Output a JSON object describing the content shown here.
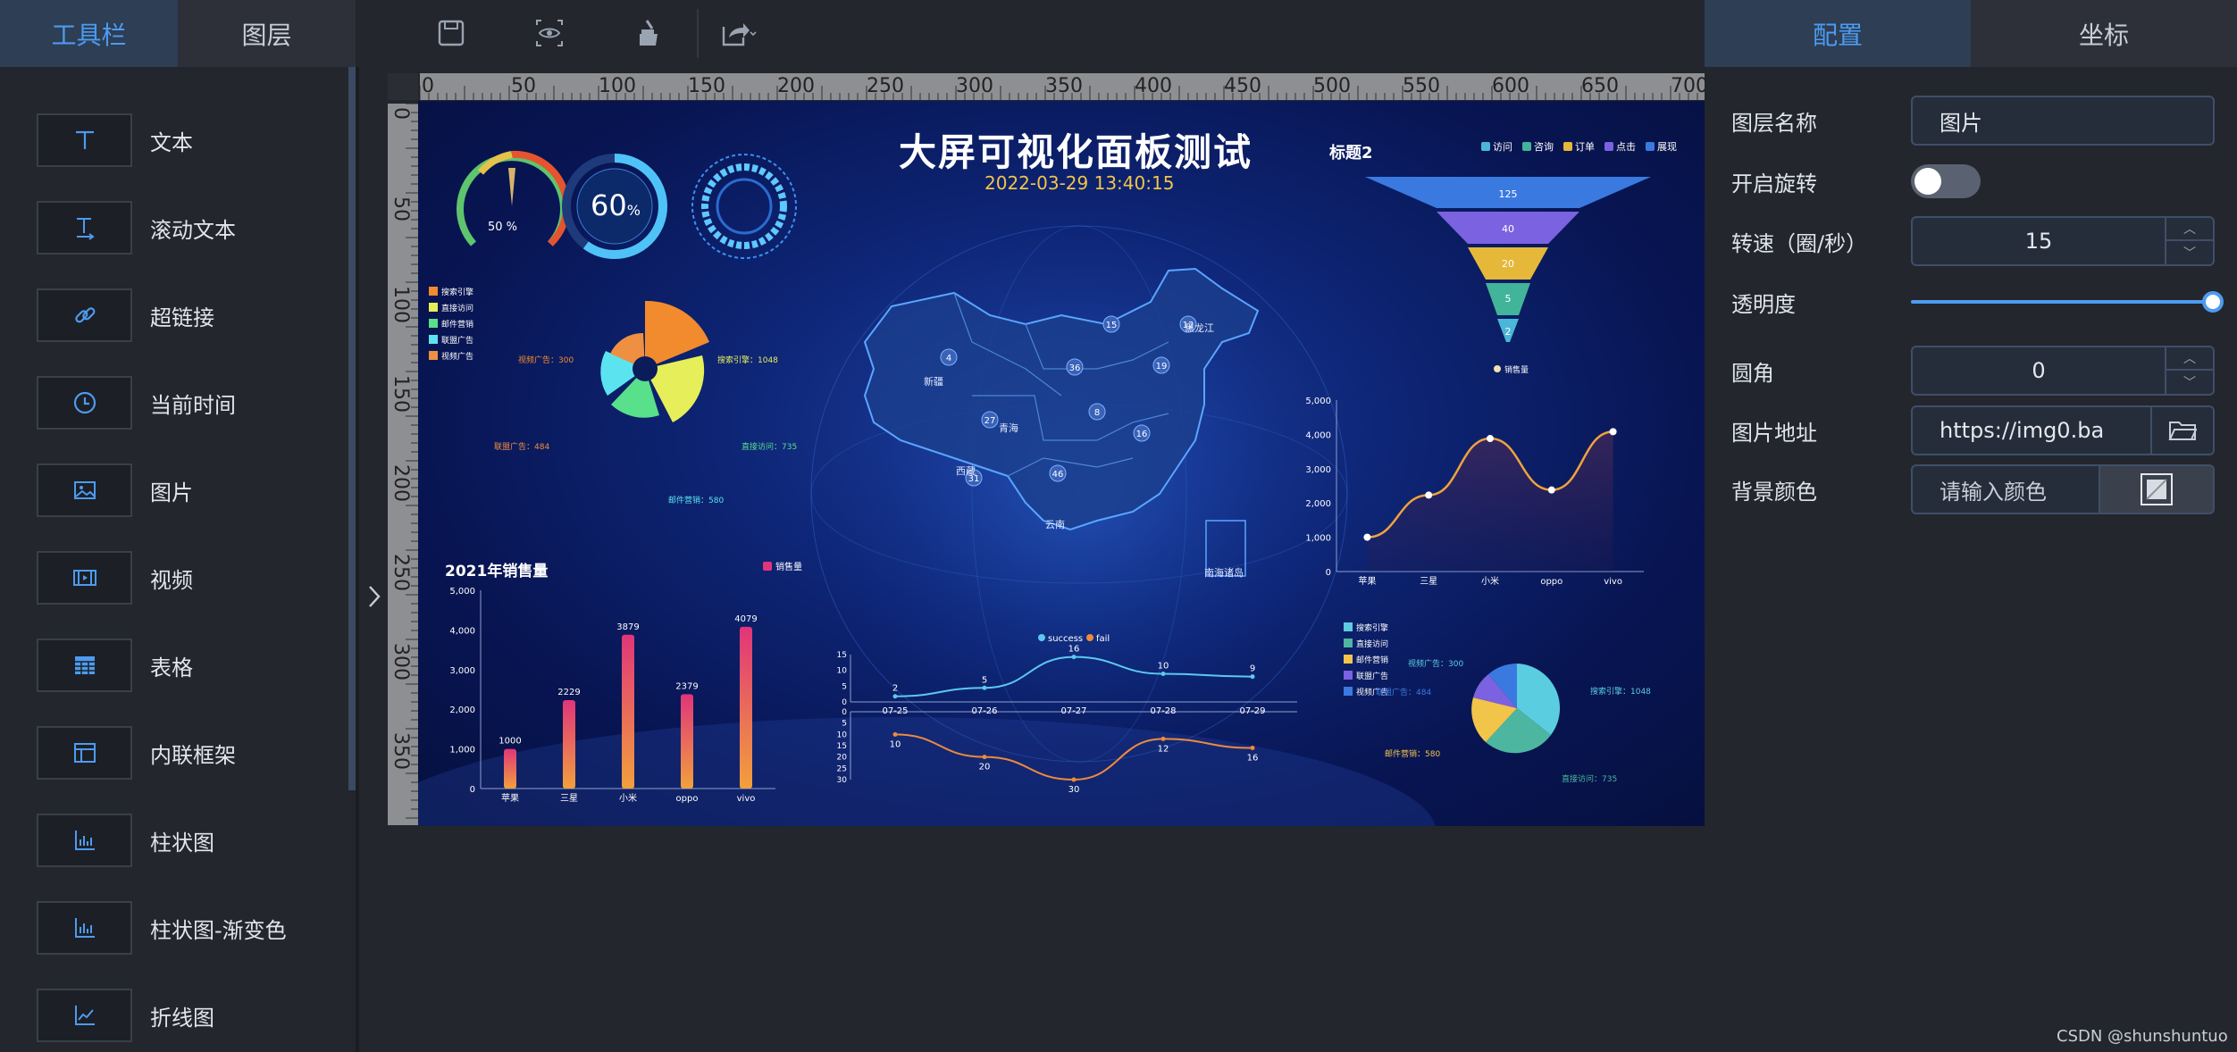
{
  "left_tabs": [
    "工具栏",
    "图层"
  ],
  "tools": [
    {
      "label": "文本",
      "icon": "text-icon"
    },
    {
      "label": "滚动文本",
      "icon": "scroll-text-icon"
    },
    {
      "label": "超链接",
      "icon": "link-icon"
    },
    {
      "label": "当前时间",
      "icon": "clock-icon"
    },
    {
      "label": "图片",
      "icon": "image-icon"
    },
    {
      "label": "视频",
      "icon": "video-icon"
    },
    {
      "label": "表格",
      "icon": "table-icon"
    },
    {
      "label": "内联框架",
      "icon": "iframe-icon"
    },
    {
      "label": "柱状图",
      "icon": "bar-chart-icon"
    },
    {
      "label": "柱状图-渐变色",
      "icon": "bar-gradient-icon"
    },
    {
      "label": "折线图",
      "icon": "line-chart-icon"
    }
  ],
  "top_toolbar": [
    "save-icon",
    "preview-icon",
    "clear-icon",
    "export-icon"
  ],
  "ruler": {
    "top_ticks": [
      "0",
      "50",
      "100",
      "150",
      "200",
      "250",
      "300",
      "350",
      "400",
      "450",
      "500",
      "550",
      "600",
      "650",
      "700"
    ],
    "left_ticks": [
      "0",
      "50",
      "100",
      "150",
      "200",
      "250",
      "300",
      "350"
    ]
  },
  "dashboard": {
    "title": "大屏可视化面板测试",
    "datetime": "2022-03-29 13:40:15",
    "subtitle": "标题2",
    "gauge_value": "50 %",
    "progress": "60",
    "progress_unit": "%",
    "funnel_legend": [
      "访问",
      "咨询",
      "订单",
      "点击",
      "展现"
    ],
    "funnel_values": [
      "125",
      "40",
      "20",
      "5",
      "2"
    ],
    "rose_legend": [
      "搜索引擎",
      "直接访问",
      "邮件营销",
      "联盟广告",
      "视频广告"
    ],
    "rose_labels": [
      "视频广告：300",
      "搜索引擎：1048",
      "直接访问：735",
      "邮件营销：580",
      "联盟广告：484"
    ],
    "sales_title": "2021年销售量",
    "sales_legend": "销售量",
    "line_legend": "销售量",
    "dual_legend": [
      "success",
      "fail"
    ],
    "dual_dates": [
      "07-25",
      "07-26",
      "07-27",
      "07-28",
      "07-29"
    ],
    "dual_success": [
      "2",
      "5",
      "16",
      "10",
      "9"
    ],
    "dual_fail": [
      "10",
      "20",
      "30",
      "12",
      "16"
    ],
    "pie_legend": [
      "搜索引擎",
      "直接访问",
      "邮件营销",
      "联盟广告",
      "视频广告"
    ],
    "pie_labels": [
      "视频广告：300",
      "联盟广告：484",
      "搜索引擎：1048",
      "邮件营销：580",
      "直接访问：735"
    ],
    "map_labels": [
      "新疆",
      "青海",
      "西藏",
      "云南",
      "黑龙江",
      "南海诸岛"
    ],
    "map_numbers": [
      "4",
      "27",
      "31",
      "15",
      "19",
      "8",
      "36",
      "46",
      "16",
      "12"
    ]
  },
  "chart_data": [
    {
      "type": "bar",
      "title": "2021年销售量",
      "categories": [
        "苹果",
        "三星",
        "小米",
        "oppo",
        "vivo"
      ],
      "series": [
        {
          "name": "销售量",
          "values": [
            1000,
            2229,
            3879,
            2379,
            4079
          ]
        }
      ],
      "ylim": [
        0,
        5000
      ],
      "yticks": [
        "0",
        "1,000",
        "2,000",
        "3,000",
        "4,000",
        "5,000"
      ]
    },
    {
      "type": "line",
      "categories": [
        "苹果",
        "三星",
        "小米",
        "oppo",
        "vivo"
      ],
      "series": [
        {
          "name": "销售量",
          "values": [
            1000,
            2229,
            3879,
            2379,
            4079
          ]
        }
      ],
      "ylim": [
        0,
        5000
      ],
      "yticks": [
        "0",
        "1,000",
        "2,000",
        "3,000",
        "4,000",
        "5,000"
      ]
    },
    {
      "type": "line",
      "categories": [
        "07-25",
        "07-26",
        "07-27",
        "07-28",
        "07-29"
      ],
      "series": [
        {
          "name": "success",
          "values": [
            2,
            5,
            16,
            10,
            9
          ]
        },
        {
          "name": "fail",
          "values": [
            10,
            20,
            30,
            12,
            16
          ]
        }
      ],
      "yticks_top": [
        "0",
        "5",
        "10",
        "15"
      ],
      "yticks_bottom": [
        "0",
        "5",
        "10",
        "15",
        "20",
        "25",
        "30"
      ]
    },
    {
      "type": "pie",
      "labels": [
        "搜索引擎",
        "直接访问",
        "邮件营销",
        "联盟广告",
        "视频广告"
      ],
      "values": [
        1048,
        735,
        580,
        484,
        300
      ]
    },
    {
      "type": "pie",
      "labels": [
        "搜索引擎",
        "直接访问",
        "邮件营销",
        "联盟广告",
        "视频广告"
      ],
      "values": [
        1048,
        735,
        580,
        484,
        300
      ]
    }
  ],
  "right_tabs": [
    "配置",
    "坐标"
  ],
  "props": {
    "layer_name_label": "图层名称",
    "layer_name_value": "图片",
    "rotate_label": "开启旋转",
    "speed_label": "转速（圈/秒）",
    "speed_value": "15",
    "opacity_label": "透明度",
    "opacity": 1,
    "radius_label": "圆角",
    "radius_value": "0",
    "image_url_label": "图片地址",
    "image_url_value": "https://img0.ba",
    "bg_color_label": "背景颜色",
    "bg_color_placeholder": "请输入颜色"
  },
  "watermark": "CSDN @shunshuntuo",
  "colors": {
    "accent": "#4d9bf0",
    "panel": "#23262c"
  }
}
